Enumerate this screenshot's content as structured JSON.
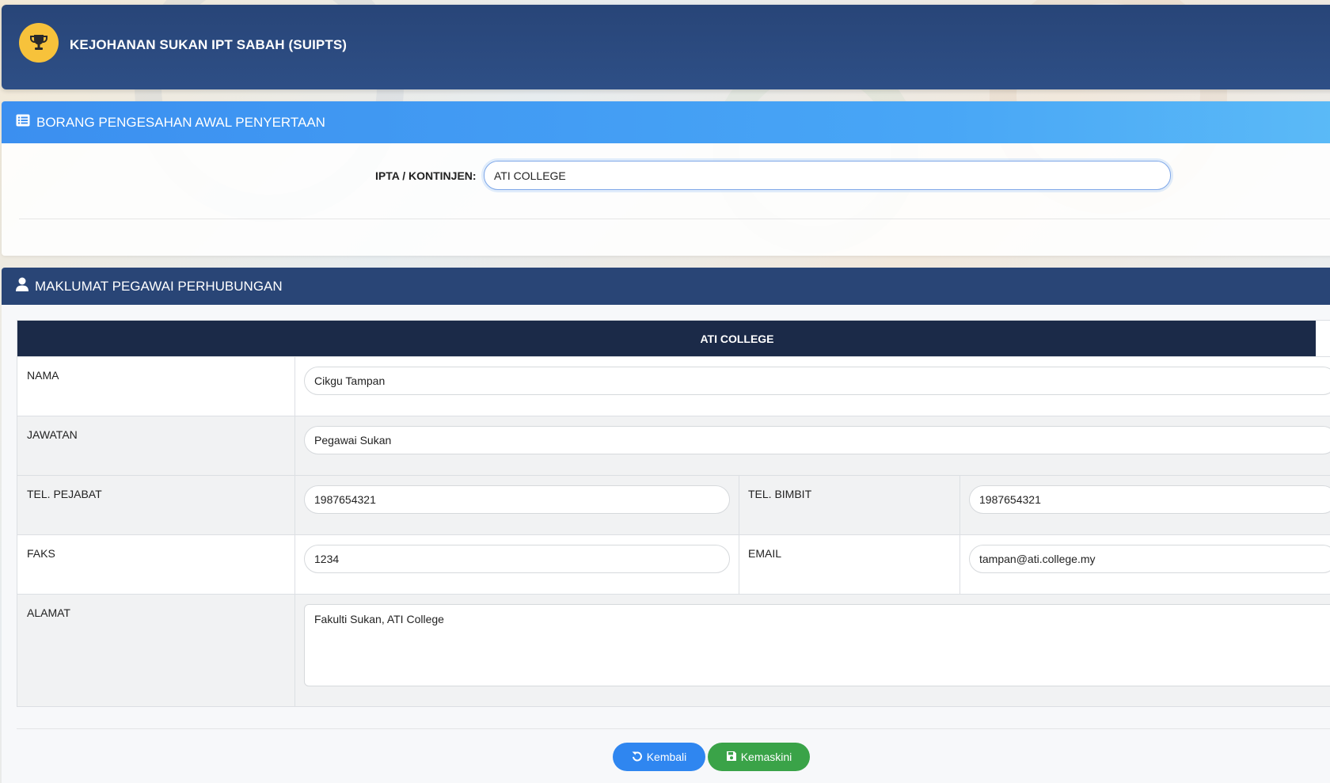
{
  "header": {
    "title": "KEJOHANAN SUKAN IPT SABAH (SUIPTS)",
    "logo_icon": "trophy-icon"
  },
  "form_card": {
    "title": "BORANG PENGESAHAN AWAL PENYERTAAN",
    "title_icon": "list-icon",
    "kontinjen_label": "IPTA / KONTINJEN:",
    "kontinjen_value": "ATI COLLEGE"
  },
  "contact_card": {
    "title": "MAKLUMAT PEGAWAI PERHUBUNGAN",
    "title_icon": "user-icon",
    "table_title": "ATI COLLEGE",
    "fields": {
      "nama_label": "NAMA",
      "nama_value": "Cikgu Tampan",
      "jawatan_label": "JAWATAN",
      "jawatan_value": "Pegawai Sukan",
      "tel_pejabat_label": "TEL. PEJABAT",
      "tel_pejabat_value": "1987654321",
      "tel_bimbit_label": "TEL. BIMBIT",
      "tel_bimbit_value": "1987654321",
      "faks_label": "FAKS",
      "faks_value": "1234",
      "email_label": "EMAIL",
      "email_value": "tampan@ati.college.my",
      "alamat_label": "ALAMAT",
      "alamat_value": "Fakulti Sukan, ATI College"
    }
  },
  "buttons": {
    "back_label": "Kembali",
    "back_icon": "undo-icon",
    "save_label": "Kemaskini",
    "save_icon": "floppy-disk-icon"
  },
  "colors": {
    "header_bg": "#284578",
    "form_head": "#3b8ff0",
    "contact_head": "#294576",
    "table_head": "#1b2a48",
    "logo_bg": "#f7c23b",
    "back_button": "#2f86f0",
    "save_button": "#3aa348"
  }
}
